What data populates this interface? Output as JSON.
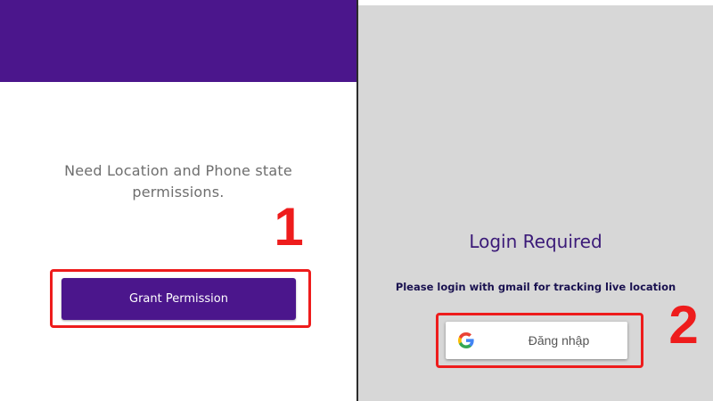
{
  "left_panel": {
    "header_color": "#4b168c",
    "message": "Need Location and Phone state permissions.",
    "grant_button_label": "Grant Permission",
    "step_number": "1"
  },
  "right_panel": {
    "title": "Login Required",
    "subtitle": "Please login with gmail for tracking live location",
    "google_button_label": "Đăng nhập",
    "google_icon": "google-g-icon",
    "step_number": "2"
  },
  "colors": {
    "accent_purple": "#4b168c",
    "highlight_red": "#ee1c1c",
    "right_background": "#d7d7d7"
  }
}
